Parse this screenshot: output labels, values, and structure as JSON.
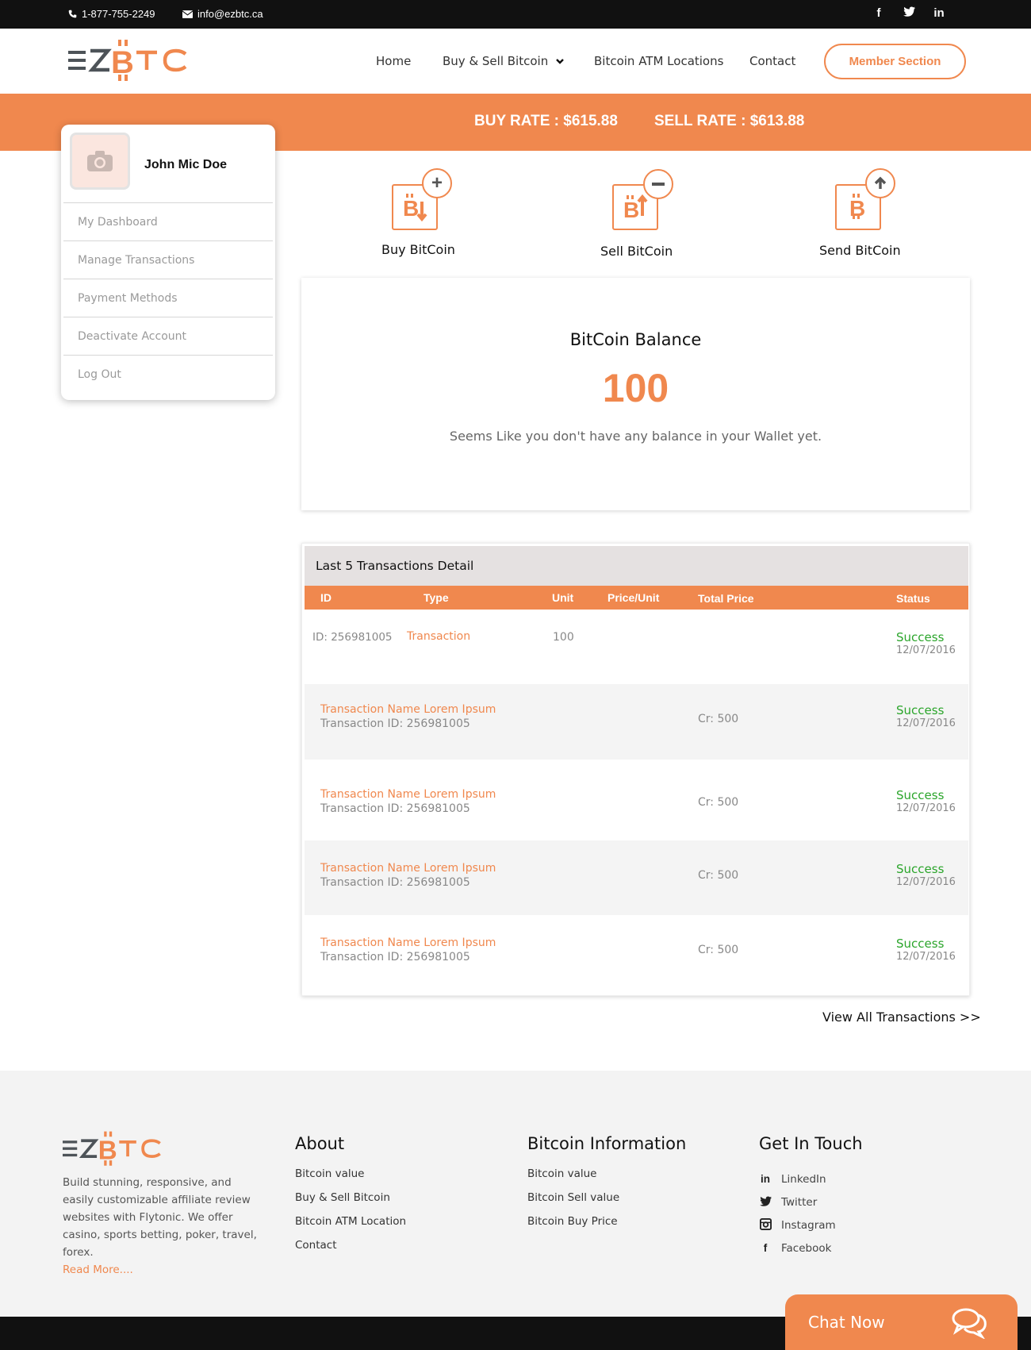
{
  "topbar": {
    "phone": "1-877-755-2249",
    "email": "info@ezbtc.ca",
    "social": [
      "f",
      "t",
      "in"
    ]
  },
  "logo": {
    "text_left": "EZ",
    "text_right": "TC"
  },
  "nav": {
    "home": "Home",
    "buy_sell": "Buy & Sell Bitcoin",
    "atm": "Bitcoin ATM Locations",
    "contact": "Contact",
    "member": "Member Section"
  },
  "rates": {
    "buy": "BUY RATE : $615.88",
    "sell": "SELL RATE : $613.88"
  },
  "profile": {
    "name": "John Mic Doe",
    "menu": [
      "My Dashboard",
      "Manage Transactions",
      "Payment Methods",
      "Deactivate Account",
      "Log Out"
    ]
  },
  "actions": {
    "buy": "Buy BitCoin",
    "sell": "Sell BitCoin",
    "send": "Send BitCoin"
  },
  "balance": {
    "title": "BitCoin Balance",
    "value": "100",
    "note": "Seems Like you don't have any balance in your Wallet yet."
  },
  "transactions": {
    "title": "Last 5 Transactions Detail",
    "columns": [
      "ID",
      "Type",
      "Unit",
      "Price/Unit",
      "Total Price",
      "Status"
    ],
    "first": {
      "id": "ID: 256981005",
      "type": "Transaction",
      "unit": "100",
      "status": "Success",
      "date": "12/07/2016"
    },
    "rows": [
      {
        "name": "Transaction Name Lorem Ipsum",
        "tid": "Transaction ID: 256981005",
        "total": "Cr: 500",
        "status": "Success",
        "date": "12/07/2016"
      },
      {
        "name": "Transaction Name Lorem Ipsum",
        "tid": "Transaction ID: 256981005",
        "total": "Cr: 500",
        "status": "Success",
        "date": "12/07/2016"
      },
      {
        "name": "Transaction Name Lorem Ipsum",
        "tid": "Transaction ID: 256981005",
        "total": "Cr: 500",
        "status": "Success",
        "date": "12/07/2016"
      },
      {
        "name": "Transaction Name Lorem Ipsum",
        "tid": "Transaction ID: 256981005",
        "total": "Cr: 500",
        "status": "Success",
        "date": "12/07/2016"
      }
    ],
    "view_all": "View All Transactions >>"
  },
  "footer": {
    "description": "Build stunning, responsive, and easily customizable affiliate review websites with Flytonic. We offer casino, sports betting, poker, travel, forex.",
    "read_more": "Read More....",
    "about": {
      "title": "About",
      "links": [
        "Bitcoin value",
        "Buy & Sell Bitcoin",
        "Bitcoin ATM Location",
        "Contact"
      ]
    },
    "info": {
      "title": "Bitcoin Information",
      "links": [
        "Bitcoin value",
        "Bitcoin Sell value",
        "Bitcoin Buy Price"
      ]
    },
    "touch": {
      "title": "Get In Touch",
      "links": [
        "LinkedIn",
        "Twitter",
        "Instagram",
        "Facebook"
      ]
    }
  },
  "chat": {
    "label": "Chat Now"
  },
  "colors": {
    "accent": "#f0884e",
    "dark": "#111111",
    "success": "#2ba52b",
    "logo_gray": "#4d5358"
  }
}
